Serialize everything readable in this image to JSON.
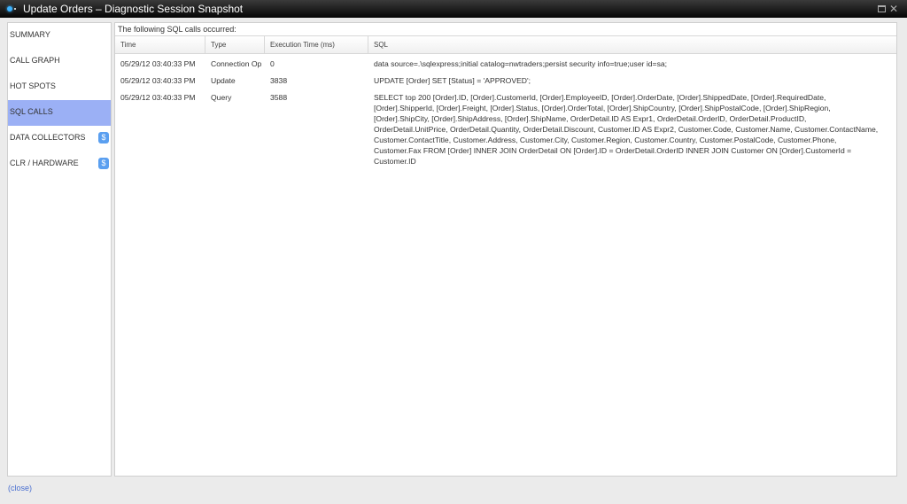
{
  "window": {
    "title": "Update Orders – Diagnostic Session Snapshot",
    "close_glyph": "✕"
  },
  "sidebar": {
    "items": [
      {
        "label": "SUMMARY",
        "active": false
      },
      {
        "label": "CALL GRAPH",
        "active": false
      },
      {
        "label": "HOT SPOTS",
        "active": false
      },
      {
        "label": "SQL CALLS",
        "active": true
      },
      {
        "label": "DATA COLLECTORS",
        "active": false,
        "badge": "$"
      },
      {
        "label": "CLR / HARDWARE",
        "active": false,
        "badge": "$"
      }
    ]
  },
  "main": {
    "caption": "The following SQL calls occurred:",
    "columns": [
      "Time",
      "Type",
      "Execution Time (ms)",
      "SQL"
    ],
    "rows": [
      {
        "time": "05/29/12 03:40:33 PM",
        "type": "Connection Op",
        "exec": "0",
        "sql": "data source=.\\sqlexpress;initial catalog=nwtraders;persist security info=true;user id=sa;"
      },
      {
        "time": "05/29/12 03:40:33 PM",
        "type": "Update",
        "exec": "3838",
        "sql": "UPDATE [Order] SET [Status] = 'APPROVED';"
      },
      {
        "time": "05/29/12 03:40:33 PM",
        "type": "Query",
        "exec": "3588",
        "sql": "SELECT top 200 [Order].ID, [Order].CustomerId, [Order].EmployeeID, [Order].OrderDate, [Order].ShippedDate, [Order].RequiredDate, [Order].ShipperId, [Order].Freight, [Order].Status, [Order].OrderTotal, [Order].ShipCountry, [Order].ShipPostalCode, [Order].ShipRegion, [Order].ShipCity, [Order].ShipAddress, [Order].ShipName, OrderDetail.ID AS Expr1, OrderDetail.OrderID, OrderDetail.ProductID, OrderDetail.UnitPrice, OrderDetail.Quantity, OrderDetail.Discount, Customer.ID AS Expr2, Customer.Code, Customer.Name, Customer.ContactName, Customer.ContactTitle, Customer.Address, Customer.City, Customer.Region, Customer.Country, Customer.PostalCode, Customer.Phone, Customer.Fax FROM [Order] INNER JOIN OrderDetail ON [Order].ID = OrderDetail.OrderID INNER JOIN Customer ON [Order].CustomerId = Customer.ID"
      }
    ]
  },
  "footer": {
    "close_label": "(close)"
  },
  "colors": {
    "active_nav": "#9bb0f5",
    "badge": "#5a9ff0",
    "link": "#4a6fd0"
  }
}
